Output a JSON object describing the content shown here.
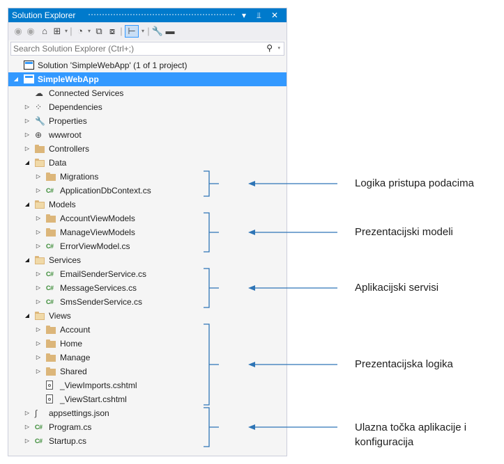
{
  "window": {
    "title": "Solution Explorer",
    "pin_glyph": "▾ ↓",
    "close_glyph": "✕"
  },
  "toolbar": {
    "icons": [
      "back-icon",
      "forward-icon",
      "home-icon",
      "switch-views-icon",
      "pending-changes-icon",
      "sync-icon",
      "collapse-all-icon",
      "show-all-files-icon",
      "preview-selected-icon",
      "properties-icon",
      "dash-icon"
    ]
  },
  "search": {
    "placeholder": "Search Solution Explorer (Ctrl+;)",
    "icon": "search-icon"
  },
  "tree": [
    {
      "label": "Solution 'SimpleWebApp' (1 of 1 project)",
      "depth": 0,
      "icon": "solution-icon",
      "expander": "none"
    },
    {
      "label": "SimpleWebApp",
      "depth": 0,
      "icon": "project-icon",
      "expander": "expanded",
      "selected": true
    },
    {
      "label": "Connected Services",
      "depth": 1,
      "icon": "connected-services-icon",
      "expander": "none"
    },
    {
      "label": "Dependencies",
      "depth": 1,
      "icon": "dependencies-icon",
      "expander": "collapsed"
    },
    {
      "label": "Properties",
      "depth": 1,
      "icon": "wrench-icon",
      "expander": "collapsed"
    },
    {
      "label": "wwwroot",
      "depth": 1,
      "icon": "globe-icon",
      "expander": "collapsed"
    },
    {
      "label": "Controllers",
      "depth": 1,
      "icon": "folder-icon",
      "expander": "collapsed"
    },
    {
      "label": "Data",
      "depth": 1,
      "icon": "folder-open-icon",
      "expander": "expanded"
    },
    {
      "label": "Migrations",
      "depth": 2,
      "icon": "folder-icon",
      "expander": "collapsed"
    },
    {
      "label": "ApplicationDbContext.cs",
      "depth": 2,
      "icon": "csharp-file-icon",
      "expander": "collapsed"
    },
    {
      "label": "Models",
      "depth": 1,
      "icon": "folder-open-icon",
      "expander": "expanded"
    },
    {
      "label": "AccountViewModels",
      "depth": 2,
      "icon": "folder-icon",
      "expander": "collapsed"
    },
    {
      "label": "ManageViewModels",
      "depth": 2,
      "icon": "folder-icon",
      "expander": "collapsed"
    },
    {
      "label": "ErrorViewModel.cs",
      "depth": 2,
      "icon": "csharp-file-icon",
      "expander": "collapsed"
    },
    {
      "label": "Services",
      "depth": 1,
      "icon": "folder-open-icon",
      "expander": "expanded"
    },
    {
      "label": "EmailSenderService.cs",
      "depth": 2,
      "icon": "csharp-file-icon",
      "expander": "collapsed"
    },
    {
      "label": "MessageServices.cs",
      "depth": 2,
      "icon": "csharp-file-icon",
      "expander": "collapsed"
    },
    {
      "label": "SmsSenderService.cs",
      "depth": 2,
      "icon": "csharp-file-icon",
      "expander": "collapsed"
    },
    {
      "label": "Views",
      "depth": 1,
      "icon": "folder-open-icon",
      "expander": "expanded"
    },
    {
      "label": "Account",
      "depth": 2,
      "icon": "folder-icon",
      "expander": "collapsed"
    },
    {
      "label": "Home",
      "depth": 2,
      "icon": "folder-icon",
      "expander": "collapsed"
    },
    {
      "label": "Manage",
      "depth": 2,
      "icon": "folder-icon",
      "expander": "collapsed"
    },
    {
      "label": "Shared",
      "depth": 2,
      "icon": "folder-icon",
      "expander": "collapsed"
    },
    {
      "label": "_ViewImports.cshtml",
      "depth": 2,
      "icon": "cshtml-file-icon",
      "expander": "none"
    },
    {
      "label": "_ViewStart.cshtml",
      "depth": 2,
      "icon": "cshtml-file-icon",
      "expander": "none"
    },
    {
      "label": "appsettings.json",
      "depth": 1,
      "icon": "json-file-icon",
      "expander": "collapsed"
    },
    {
      "label": "Program.cs",
      "depth": 1,
      "icon": "csharp-file-icon",
      "expander": "collapsed"
    },
    {
      "label": "Startup.cs",
      "depth": 1,
      "icon": "csharp-file-icon",
      "expander": "collapsed"
    }
  ],
  "annotations": [
    {
      "text": "Logika pristupa podacima",
      "from_row": 8,
      "to_row": 9
    },
    {
      "text": "Prezentacijski modeli",
      "from_row": 11,
      "to_row": 13
    },
    {
      "text": "Aplikacijski servisi",
      "from_row": 15,
      "to_row": 17
    },
    {
      "text": "Prezentacijska logika",
      "from_row": 19,
      "to_row": 24
    },
    {
      "text": "Ulazna točka aplikacije i konfiguracija",
      "from_row": 25,
      "to_row": 27
    }
  ],
  "colors": {
    "accent": "#007acc",
    "selection": "#3399ff",
    "folder": "#dcb67a",
    "csharp": "#388a34",
    "annotation_line": "#2e75b6"
  }
}
